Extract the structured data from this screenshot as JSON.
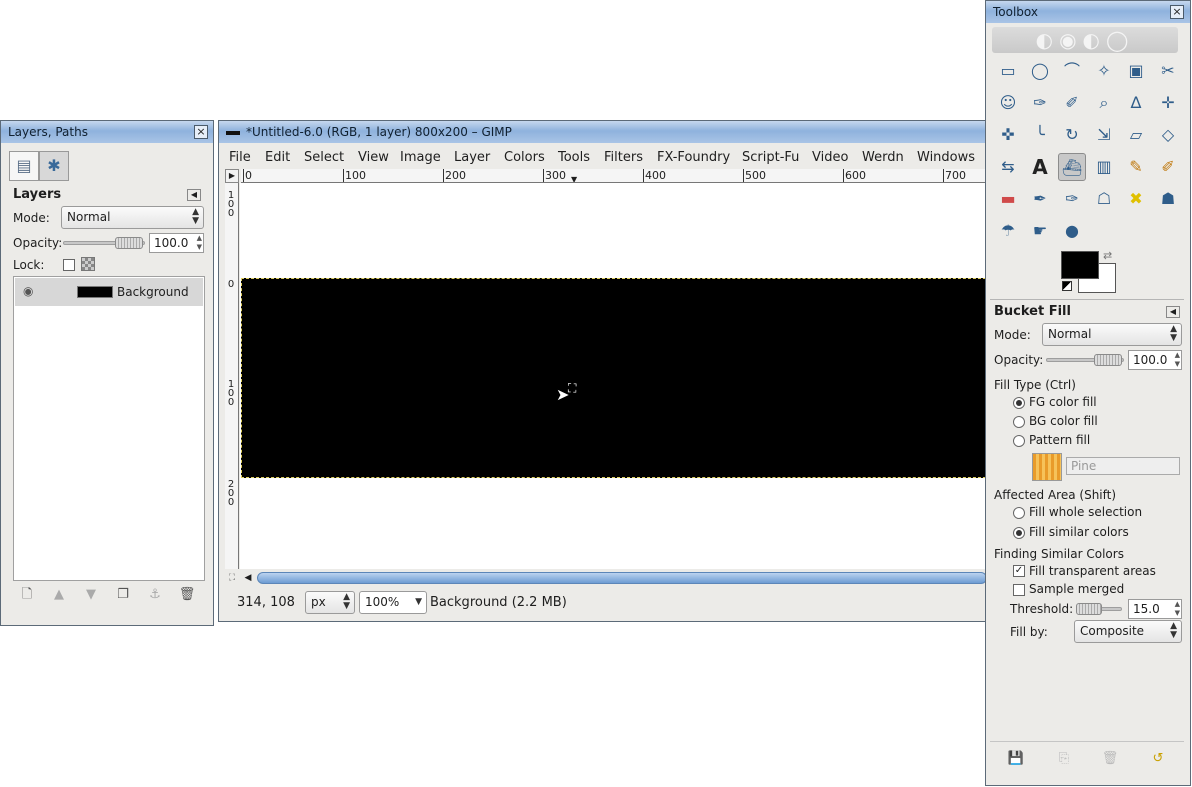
{
  "image_window": {
    "title": "*Untitled-6.0 (RGB, 1 layer) 800x200 – GIMP",
    "menu": [
      "File",
      "Edit",
      "Select",
      "View",
      "Image",
      "Layer",
      "Colors",
      "Tools",
      "Filters",
      "FX-Foundry",
      "Script-Fu",
      "Video",
      "Werdn",
      "Windows"
    ],
    "ruler_h": [
      "0",
      "100",
      "200",
      "300",
      "400",
      "500",
      "600",
      "700"
    ],
    "ruler_v_left": [
      "1\n0\n0",
      "0",
      "1\n0\n0",
      "2\n0\n0"
    ],
    "status": {
      "coords": "314, 108",
      "unit": "px",
      "zoom": "100%",
      "info": "Background (2.2 MB)"
    }
  },
  "layers_panel": {
    "title": "Layers, Paths",
    "heading": "Layers",
    "mode_label": "Mode:",
    "mode_value": "Normal",
    "opacity_label": "Opacity:",
    "opacity_value": "100.0",
    "opacity_level": 1.0,
    "lock_label": "Lock:",
    "layers": [
      {
        "name": "Background",
        "visible": true,
        "thumb_color": "#000000"
      }
    ],
    "bottom_icons": [
      "new-layer-icon",
      "raise-layer-icon",
      "lower-layer-icon",
      "duplicate-layer-icon",
      "anchor-icon",
      "delete-layer-icon"
    ]
  },
  "toolbox": {
    "title": "Toolbox",
    "tools": [
      "rect-select-icon",
      "ellipse-select-icon",
      "free-select-icon",
      "fuzzy-select-icon",
      "select-by-color-icon",
      "scissors-icon",
      "foreground-select-icon",
      "paths-icon",
      "color-picker-icon",
      "zoom-icon",
      "measure-icon",
      "move-icon",
      "align-icon",
      "crop-icon",
      "rotate-icon",
      "scale-icon",
      "shear-icon",
      "perspective-icon",
      "flip-icon",
      "text-icon",
      "bucket-fill-icon",
      "blend-icon",
      "pencil-icon",
      "paintbrush-icon",
      "eraser-icon",
      "airbrush-icon",
      "ink-icon",
      "clone-icon",
      "heal-icon",
      "perspective-clone-icon",
      "blur-icon",
      "smudge-icon",
      "dodge-burn-icon"
    ],
    "tool_glyphs": [
      "▭",
      "◯",
      "⌒",
      "✧",
      "▣",
      "✂",
      "☺",
      "✑",
      "✐",
      "⌕",
      "∆",
      "✛",
      "✜",
      "╰",
      "↻",
      "⇲",
      "▱",
      "◇",
      "⇆",
      "A",
      "⛴",
      "▥",
      "✎",
      "✐",
      "▬",
      "✒",
      "✑",
      "☖",
      "✖",
      "☗",
      "☂",
      "☛",
      "●"
    ],
    "active_tool_index": 20,
    "fg_color": "#000000",
    "bg_color": "#ffffff",
    "options": {
      "title": "Bucket Fill",
      "mode_label": "Mode:",
      "mode_value": "Normal",
      "opacity_label": "Opacity:",
      "opacity_value": "100.0",
      "opacity_level": 1.0,
      "fill_type_label": "Fill Type  (Ctrl)",
      "fill_types": [
        {
          "label": "FG color fill",
          "selected": true
        },
        {
          "label": "BG color fill",
          "selected": false
        },
        {
          "label": "Pattern fill",
          "selected": false
        }
      ],
      "pattern_name": "Pine",
      "affected_label": "Affected Area  (Shift)",
      "affected": [
        {
          "label": "Fill whole selection",
          "selected": false
        },
        {
          "label": "Fill similar colors",
          "selected": true
        }
      ],
      "finding_label": "Finding Similar Colors",
      "fill_transparent_label": "Fill transparent areas",
      "fill_transparent_checked": true,
      "sample_merged_label": "Sample merged",
      "sample_merged_checked": false,
      "threshold_label": "Threshold:",
      "threshold_value": "15.0",
      "threshold_level": 0.06,
      "fill_by_label": "Fill by:",
      "fill_by_value": "Composite"
    },
    "bottom_icons": [
      "save-options-icon",
      "restore-options-icon",
      "delete-options-icon",
      "reset-options-icon"
    ]
  }
}
